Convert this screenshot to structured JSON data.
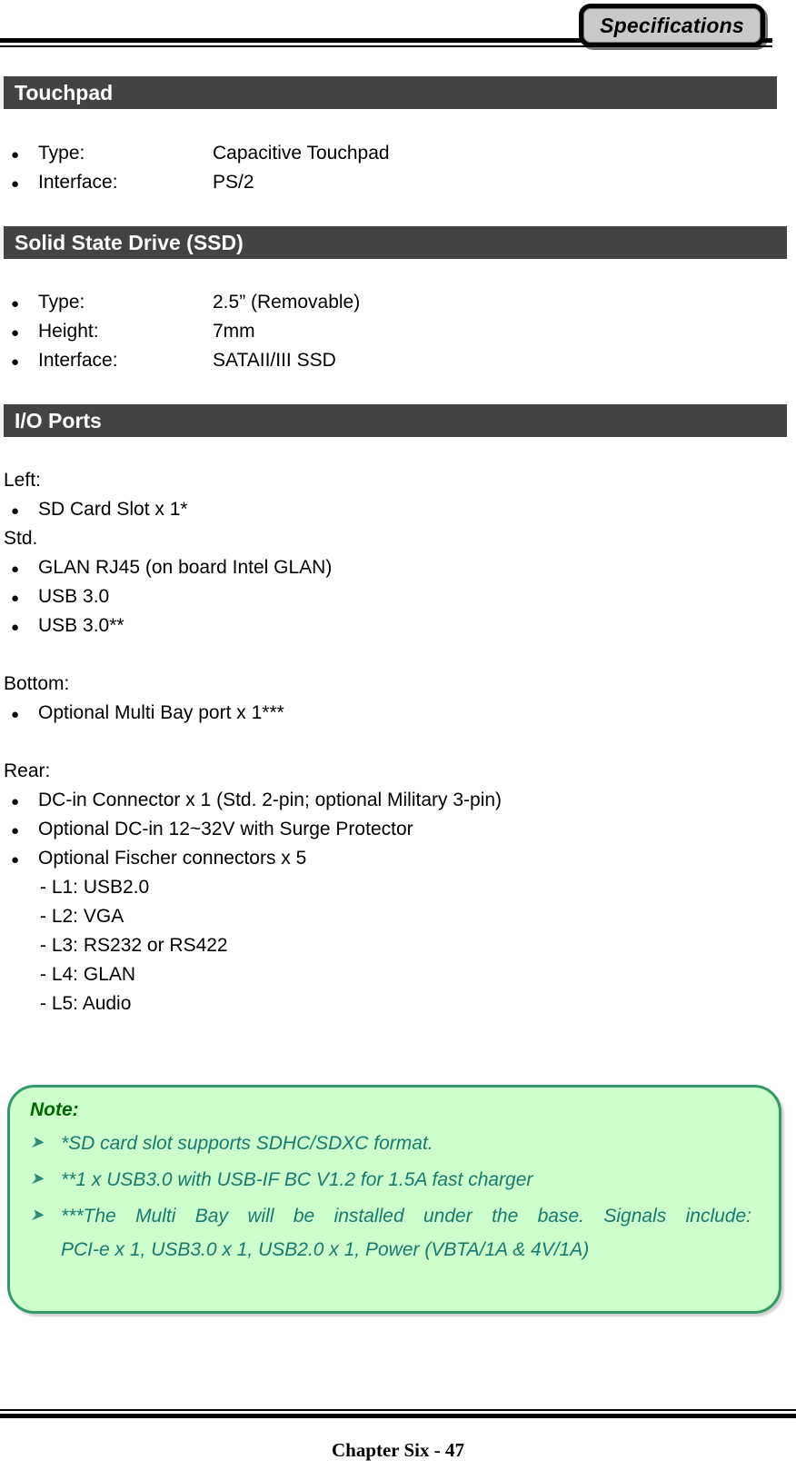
{
  "header": {
    "tab_label": "Specifications"
  },
  "sections": [
    {
      "id": "touchpad",
      "title": "Touchpad",
      "rows": [
        {
          "term": "Type:",
          "value": "Capacitive Touchpad"
        },
        {
          "term": "Interface:",
          "value": "PS/2"
        }
      ]
    },
    {
      "id": "ssd",
      "title": "Solid State Drive (SSD)",
      "rows": [
        {
          "term": "Type:",
          "value": "2.5” (Removable)"
        },
        {
          "term": "Height:",
          "value": "7mm"
        },
        {
          "term": "Interface:",
          "value": "SATAII/III SSD"
        }
      ]
    },
    {
      "id": "io",
      "title": "I/O Ports",
      "groups": [
        {
          "heading": "Left:",
          "items": [
            "SD Card Slot x 1*"
          ],
          "subheading": "Std.",
          "items2": [
            "GLAN RJ45 (on board Intel GLAN)",
            "USB 3.0",
            "USB 3.0**"
          ]
        },
        {
          "heading": "Bottom:",
          "items": [
            "Optional Multi Bay port x 1***"
          ]
        },
        {
          "heading": "Rear:",
          "items": [
            "DC-in Connector x 1 (Std. 2-pin; optional Military 3-pin)",
            "Optional DC-in 12~32V with Surge Protector",
            "Optional Fischer connectors x 5"
          ],
          "sublines": [
            "- L1: USB2.0",
            "- L2: VGA",
            "- L3: RS232 or RS422",
            "- L4: GLAN",
            "- L5: Audio"
          ]
        }
      ]
    }
  ],
  "note": {
    "title": "Note:",
    "items": [
      "*SD card slot supports SDHC/SDXC format.",
      "**1 x USB3.0 with USB-IF BC V1.2 for 1.5A fast charger",
      "***The Multi Bay will be installed under the base. Signals include:",
      "PCI-e x 1, USB3.0 x 1, USB2.0 x 1, Power (VBTA/1A & 4V/1A)"
    ]
  },
  "footer": {
    "text": "Chapter Six - 47"
  },
  "glyphs": {
    "bullet": "●",
    "arrow": "➤"
  },
  "colors": {
    "section_bar": "#434343",
    "section_text": "#ffffff",
    "note_fill": "#ccffcc",
    "note_border": "#339966",
    "note_title": "#006600",
    "note_text": "#1a7a6e",
    "tab_fill": "#c9c9c9"
  }
}
